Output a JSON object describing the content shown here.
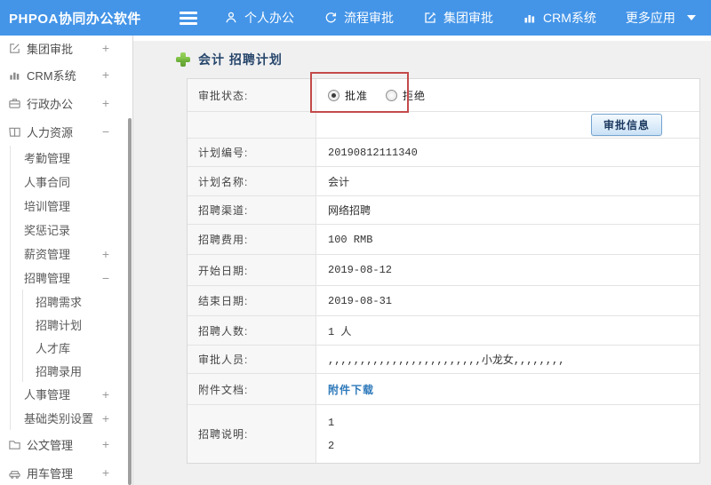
{
  "colors": {
    "topbar_blue": "#4495e8",
    "annotation_red": "#c44a4a",
    "link_blue": "#2e79ba",
    "breadcrumb_navy": "#27466b",
    "plus_green": "#6cb52d"
  },
  "topbar": {
    "brand": "PHPOA协同办公软件",
    "items": [
      {
        "label": "个人办公",
        "icon": "user-icon"
      },
      {
        "label": "流程审批",
        "icon": "refresh-icon"
      },
      {
        "label": "集团审批",
        "icon": "edit-icon"
      },
      {
        "label": "CRM系统",
        "icon": "bar-chart-icon"
      },
      {
        "label": "更多应用",
        "icon": "caret-down-icon"
      }
    ]
  },
  "sidebar": {
    "items": [
      {
        "label": "集团审批",
        "icon": "edit-icon",
        "toggle": "+",
        "level": 1
      },
      {
        "label": "CRM系统",
        "icon": "bar-chart-icon",
        "toggle": "+",
        "level": 1
      },
      {
        "label": "行政办公",
        "icon": "briefcase-icon",
        "toggle": "+",
        "level": 1
      },
      {
        "label": "人力资源",
        "icon": "book-icon",
        "toggle": "−",
        "level": 1
      },
      {
        "label": "考勤管理",
        "level": 2
      },
      {
        "label": "人事合同",
        "level": 2
      },
      {
        "label": "培训管理",
        "level": 2
      },
      {
        "label": "奖惩记录",
        "level": 2
      },
      {
        "label": "薪资管理",
        "toggle": "+",
        "level": 2
      },
      {
        "label": "招聘管理",
        "toggle": "−",
        "level": 2
      },
      {
        "label": "招聘需求",
        "level": 3
      },
      {
        "label": "招聘计划",
        "level": 3
      },
      {
        "label": "人才库",
        "level": 3
      },
      {
        "label": "招聘录用",
        "level": 3
      },
      {
        "label": "人事管理",
        "toggle": "+",
        "level": 2
      },
      {
        "label": "基础类别设置",
        "toggle": "+",
        "level": 2
      },
      {
        "label": "公文管理",
        "icon": "folder-icon",
        "toggle": "+",
        "level": 1
      },
      {
        "label": "用车管理",
        "icon": "car-icon",
        "toggle": "+",
        "level": 1
      }
    ]
  },
  "breadcrumb": {
    "title": "会计 招聘计划"
  },
  "form": {
    "status_label": "审批状态:",
    "radio_approve": "批准",
    "radio_reject": "拒绝",
    "approve_info_button": "审批信息",
    "rows": [
      {
        "label": "计划编号:",
        "value": "20190812111340"
      },
      {
        "label": "计划名称:",
        "value": "会计"
      },
      {
        "label": "招聘渠道:",
        "value": "网络招聘"
      },
      {
        "label": "招聘费用:",
        "value": "100 RMB"
      },
      {
        "label": "开始日期:",
        "value": "2019-08-12"
      },
      {
        "label": "结束日期:",
        "value": "2019-08-31"
      },
      {
        "label": "招聘人数:",
        "value": "1 人"
      },
      {
        "label": "审批人员:",
        "value": ",,,,,,,,,,,,,,,,,,,,,,,,小龙女,,,,,,,,"
      }
    ],
    "attachment_label": "附件文档:",
    "attachment_link": "附件下载",
    "description_label": "招聘说明:",
    "description_lines": [
      "1",
      "2"
    ]
  }
}
